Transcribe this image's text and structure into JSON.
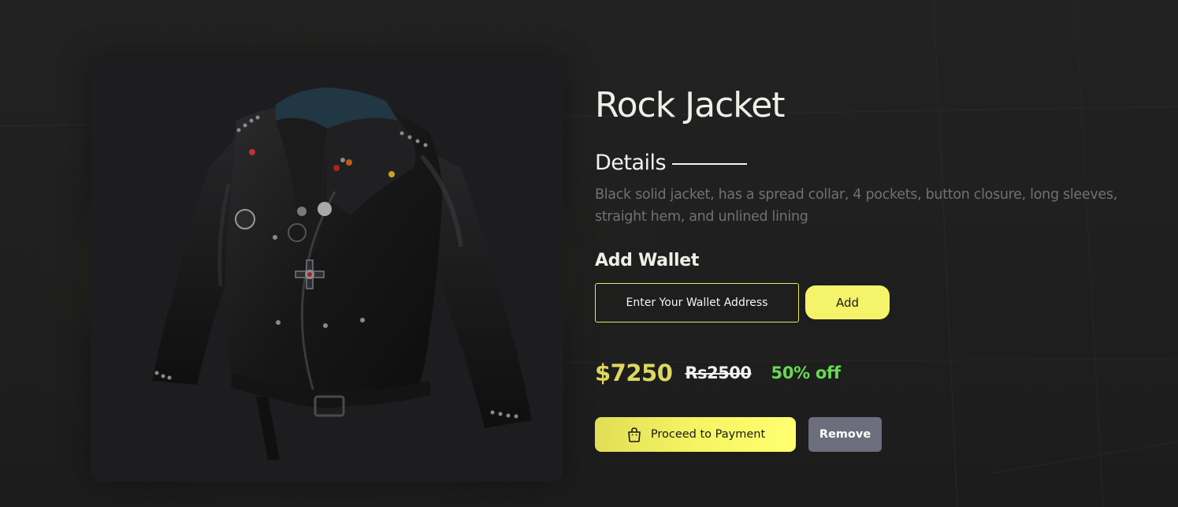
{
  "product": {
    "name": "Rock Jacket",
    "image_icon": "leather-jacket-image",
    "details_heading": "Details",
    "description": "Black solid jacket, has a spread collar, 4 pockets, button closure, long sleeves, straight hem, and unlined lining"
  },
  "wallet": {
    "heading": "Add Wallet",
    "input_placeholder": "Enter Your Wallet Address",
    "input_value": "",
    "add_label": "Add"
  },
  "pricing": {
    "current": "$7250",
    "original": "Rs2500",
    "discount": "50% off"
  },
  "actions": {
    "pay_label": "Proceed to Payment",
    "pay_icon": "shopping-bag-icon",
    "remove_label": "Remove"
  },
  "colors": {
    "accent": "#f4f36a",
    "price": "#ddd85e",
    "discount": "#67db52",
    "remove": "#6c6e7d",
    "background": "#1f1f1f"
  }
}
